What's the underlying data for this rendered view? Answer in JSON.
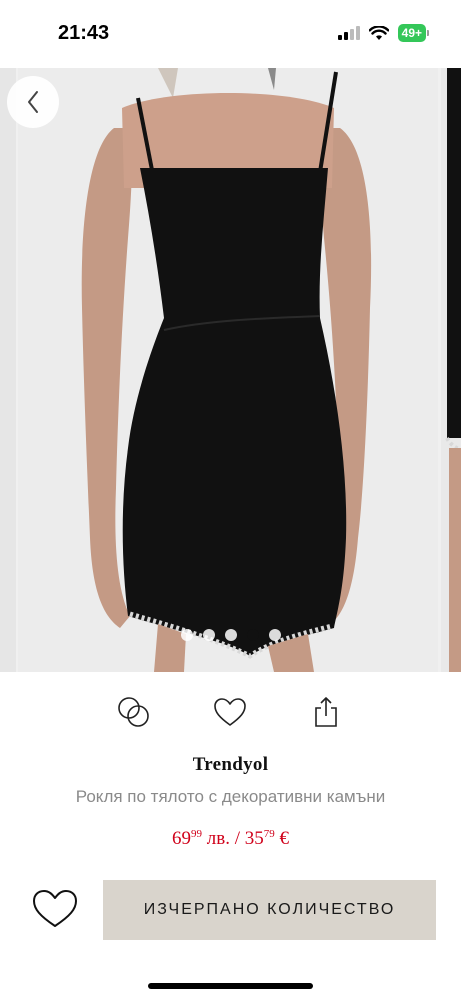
{
  "status_bar": {
    "time": "21:43",
    "battery": "49+"
  },
  "gallery": {
    "dots_count": 5,
    "active_dot_index": 3
  },
  "product": {
    "brand": "Trendyol",
    "name": "Рокля по тялото с декоративни камъни",
    "price_bgn_int": "69",
    "price_bgn_dec": "99",
    "price_bgn_unit": " лв. / ",
    "price_eur_int": "35",
    "price_eur_dec": "79",
    "price_eur_unit": " €"
  },
  "buttons": {
    "soldout_label": "ИЗЧЕРПАНО КОЛИЧЕСТВО"
  },
  "colors": {
    "price": "#d0021b",
    "soldout_bg": "#d9d4cc",
    "battery": "#34c759"
  }
}
